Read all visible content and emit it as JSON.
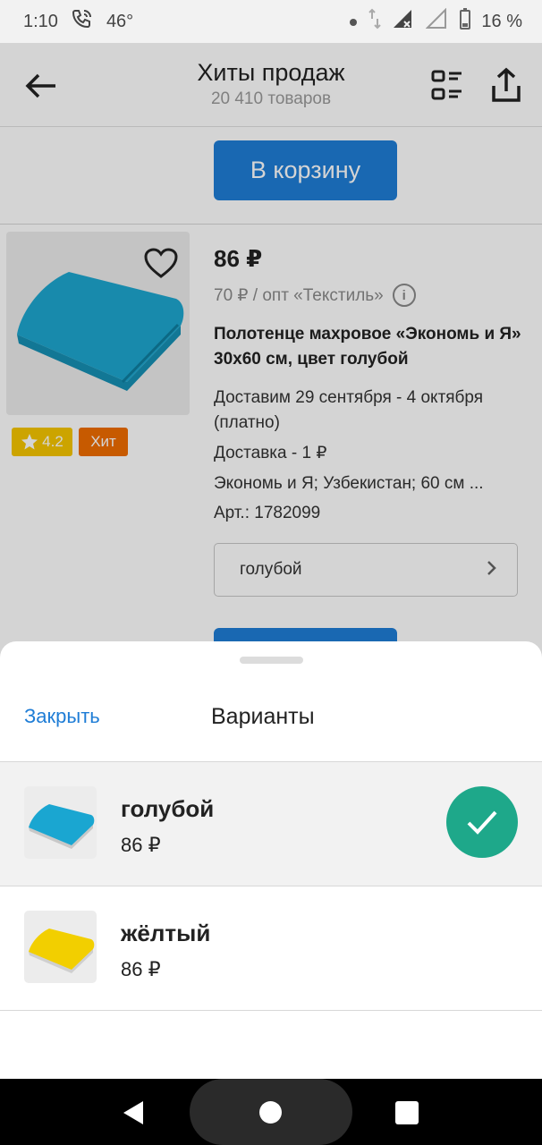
{
  "status_bar": {
    "time": "1:10",
    "temperature": "46°",
    "battery": "16 %"
  },
  "header": {
    "title": "Хиты продаж",
    "subtitle": "20 410 товаров"
  },
  "top_button": {
    "label": "В корзину"
  },
  "product": {
    "rating": "4.2",
    "badge": "Хит",
    "price": "86 ₽",
    "wholesale": "70 ₽ / опт «Текстиль»",
    "name": "Полотенце махровое «Экономь и Я» 30х60 см, цвет голубой",
    "delivery_dates": "Доставим 29 сентября - 4 октября (платно)",
    "delivery_cost": "Доставка - 1 ₽",
    "attributes": "Экономь и Я; Узбекистан; 60 см ...",
    "article": "Арт.: 1782099",
    "selected_variant": "голубой"
  },
  "sheet": {
    "close_label": "Закрыть",
    "title": "Варианты",
    "variants": [
      {
        "name": "голубой",
        "price": "86 ₽",
        "color": "#1aa6d1",
        "selected": true
      },
      {
        "name": "жёлтый",
        "price": "86 ₽",
        "color": "#f2cf00",
        "selected": false
      }
    ]
  },
  "colors": {
    "accent_blue": "#1f7dd6",
    "check_green": "#1ea88a",
    "rating_yellow": "#f6c600",
    "hit_orange": "#f06d00"
  },
  "icons": [
    "phone-wifi-icon",
    "dot-icon",
    "data-arrows-icon",
    "signal-icon",
    "battery-icon",
    "back-arrow-icon",
    "list-view-icon",
    "share-icon",
    "heart-icon",
    "star-icon",
    "info-icon",
    "chevron-right-icon",
    "check-icon"
  ]
}
